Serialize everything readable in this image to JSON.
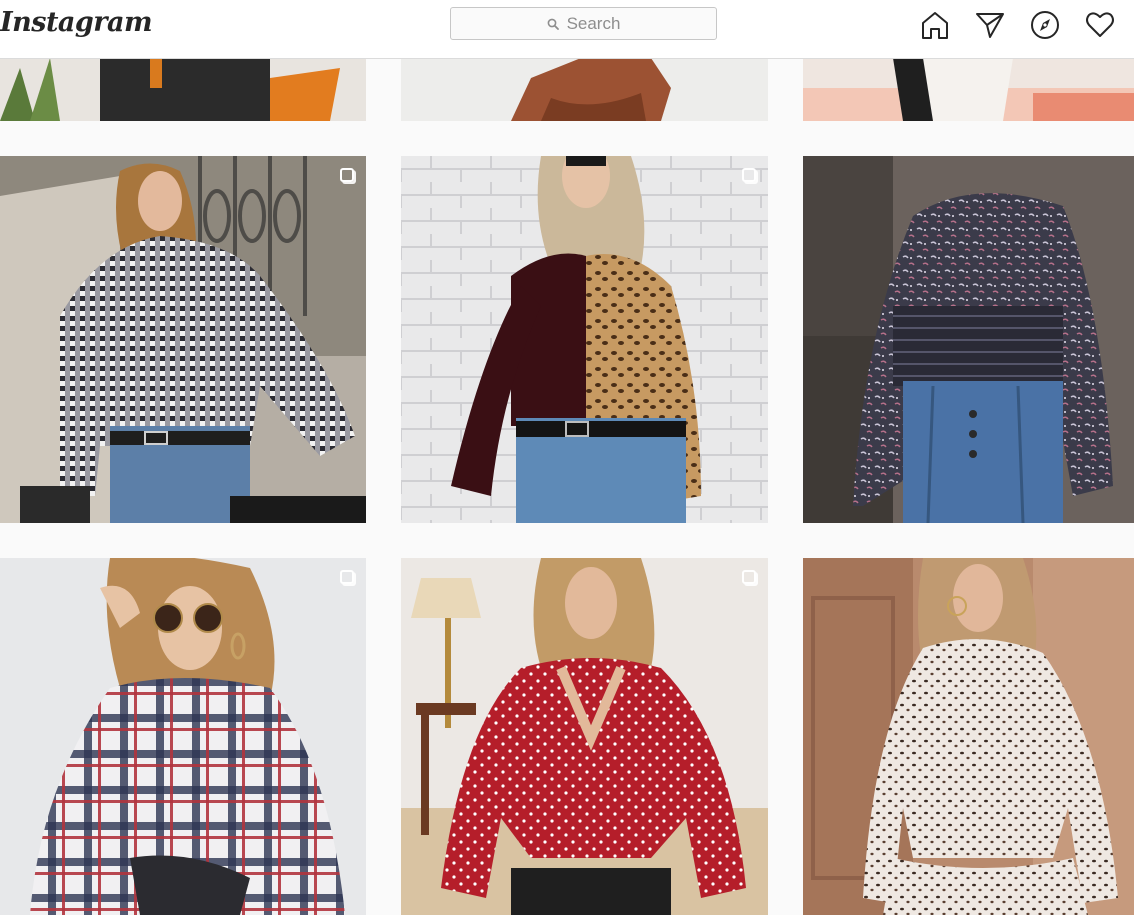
{
  "header": {
    "logo_text": "Instagram",
    "search_placeholder": "Search"
  },
  "nav": {
    "icons": [
      "home-icon",
      "direct-message-icon",
      "explore-icon",
      "activity-heart-icon"
    ]
  },
  "posts": [
    {
      "name": "post-top-1",
      "alt": "",
      "multi": false
    },
    {
      "name": "post-top-2",
      "alt": "",
      "multi": false
    },
    {
      "name": "post-top-3",
      "alt": "",
      "multi": false
    },
    {
      "name": "post-gingham-shirt",
      "alt": "",
      "multi": true
    },
    {
      "name": "post-leopard-colorblock-top",
      "alt": "",
      "multi": true
    },
    {
      "name": "post-floral-shirred-blouse",
      "alt": "",
      "multi": false
    },
    {
      "name": "post-plaid-tie-front-shirt",
      "alt": "",
      "multi": true
    },
    {
      "name": "post-red-polka-dot-blouse",
      "alt": "",
      "multi": true
    },
    {
      "name": "post-leopard-print-tiered-blouse",
      "alt": "",
      "multi": false
    }
  ],
  "colors": {
    "header_bg": "#ffffff",
    "page_bg": "#fafafa",
    "border": "#dbdbdb",
    "text": "#262626",
    "muted": "#8e8e8e"
  }
}
